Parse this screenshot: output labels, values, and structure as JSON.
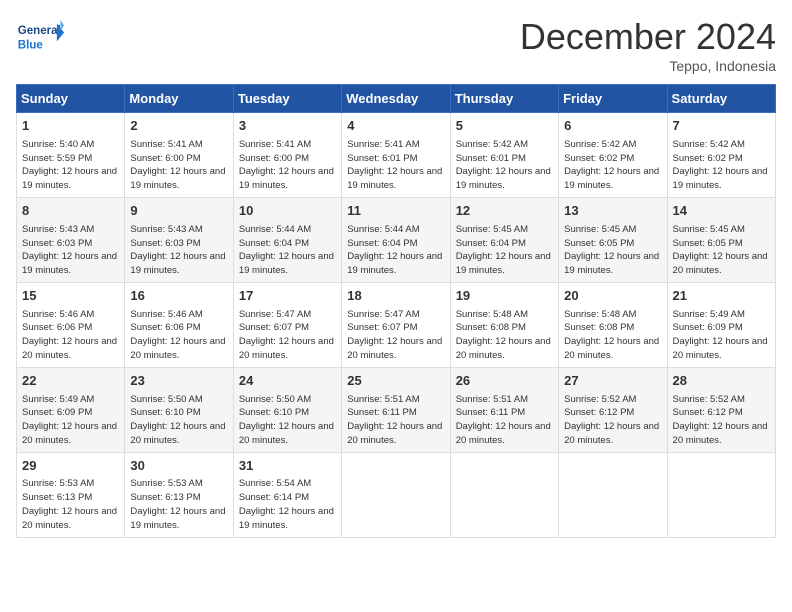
{
  "logo": {
    "general": "General",
    "blue": "Blue"
  },
  "title": "December 2024",
  "subtitle": "Teppo, Indonesia",
  "days_header": [
    "Sunday",
    "Monday",
    "Tuesday",
    "Wednesday",
    "Thursday",
    "Friday",
    "Saturday"
  ],
  "weeks": [
    [
      {
        "day": "1",
        "sunrise": "5:40 AM",
        "sunset": "5:59 PM",
        "daylight": "12 hours and 19 minutes."
      },
      {
        "day": "2",
        "sunrise": "5:41 AM",
        "sunset": "6:00 PM",
        "daylight": "12 hours and 19 minutes."
      },
      {
        "day": "3",
        "sunrise": "5:41 AM",
        "sunset": "6:00 PM",
        "daylight": "12 hours and 19 minutes."
      },
      {
        "day": "4",
        "sunrise": "5:41 AM",
        "sunset": "6:01 PM",
        "daylight": "12 hours and 19 minutes."
      },
      {
        "day": "5",
        "sunrise": "5:42 AM",
        "sunset": "6:01 PM",
        "daylight": "12 hours and 19 minutes."
      },
      {
        "day": "6",
        "sunrise": "5:42 AM",
        "sunset": "6:02 PM",
        "daylight": "12 hours and 19 minutes."
      },
      {
        "day": "7",
        "sunrise": "5:42 AM",
        "sunset": "6:02 PM",
        "daylight": "12 hours and 19 minutes."
      }
    ],
    [
      {
        "day": "8",
        "sunrise": "5:43 AM",
        "sunset": "6:03 PM",
        "daylight": "12 hours and 19 minutes."
      },
      {
        "day": "9",
        "sunrise": "5:43 AM",
        "sunset": "6:03 PM",
        "daylight": "12 hours and 19 minutes."
      },
      {
        "day": "10",
        "sunrise": "5:44 AM",
        "sunset": "6:04 PM",
        "daylight": "12 hours and 19 minutes."
      },
      {
        "day": "11",
        "sunrise": "5:44 AM",
        "sunset": "6:04 PM",
        "daylight": "12 hours and 19 minutes."
      },
      {
        "day": "12",
        "sunrise": "5:45 AM",
        "sunset": "6:04 PM",
        "daylight": "12 hours and 19 minutes."
      },
      {
        "day": "13",
        "sunrise": "5:45 AM",
        "sunset": "6:05 PM",
        "daylight": "12 hours and 19 minutes."
      },
      {
        "day": "14",
        "sunrise": "5:45 AM",
        "sunset": "6:05 PM",
        "daylight": "12 hours and 20 minutes."
      }
    ],
    [
      {
        "day": "15",
        "sunrise": "5:46 AM",
        "sunset": "6:06 PM",
        "daylight": "12 hours and 20 minutes."
      },
      {
        "day": "16",
        "sunrise": "5:46 AM",
        "sunset": "6:06 PM",
        "daylight": "12 hours and 20 minutes."
      },
      {
        "day": "17",
        "sunrise": "5:47 AM",
        "sunset": "6:07 PM",
        "daylight": "12 hours and 20 minutes."
      },
      {
        "day": "18",
        "sunrise": "5:47 AM",
        "sunset": "6:07 PM",
        "daylight": "12 hours and 20 minutes."
      },
      {
        "day": "19",
        "sunrise": "5:48 AM",
        "sunset": "6:08 PM",
        "daylight": "12 hours and 20 minutes."
      },
      {
        "day": "20",
        "sunrise": "5:48 AM",
        "sunset": "6:08 PM",
        "daylight": "12 hours and 20 minutes."
      },
      {
        "day": "21",
        "sunrise": "5:49 AM",
        "sunset": "6:09 PM",
        "daylight": "12 hours and 20 minutes."
      }
    ],
    [
      {
        "day": "22",
        "sunrise": "5:49 AM",
        "sunset": "6:09 PM",
        "daylight": "12 hours and 20 minutes."
      },
      {
        "day": "23",
        "sunrise": "5:50 AM",
        "sunset": "6:10 PM",
        "daylight": "12 hours and 20 minutes."
      },
      {
        "day": "24",
        "sunrise": "5:50 AM",
        "sunset": "6:10 PM",
        "daylight": "12 hours and 20 minutes."
      },
      {
        "day": "25",
        "sunrise": "5:51 AM",
        "sunset": "6:11 PM",
        "daylight": "12 hours and 20 minutes."
      },
      {
        "day": "26",
        "sunrise": "5:51 AM",
        "sunset": "6:11 PM",
        "daylight": "12 hours and 20 minutes."
      },
      {
        "day": "27",
        "sunrise": "5:52 AM",
        "sunset": "6:12 PM",
        "daylight": "12 hours and 20 minutes."
      },
      {
        "day": "28",
        "sunrise": "5:52 AM",
        "sunset": "6:12 PM",
        "daylight": "12 hours and 20 minutes."
      }
    ],
    [
      {
        "day": "29",
        "sunrise": "5:53 AM",
        "sunset": "6:13 PM",
        "daylight": "12 hours and 20 minutes."
      },
      {
        "day": "30",
        "sunrise": "5:53 AM",
        "sunset": "6:13 PM",
        "daylight": "12 hours and 19 minutes."
      },
      {
        "day": "31",
        "sunrise": "5:54 AM",
        "sunset": "6:14 PM",
        "daylight": "12 hours and 19 minutes."
      },
      null,
      null,
      null,
      null
    ]
  ],
  "labels": {
    "sunrise": "Sunrise:",
    "sunset": "Sunset:",
    "daylight": "Daylight:"
  }
}
